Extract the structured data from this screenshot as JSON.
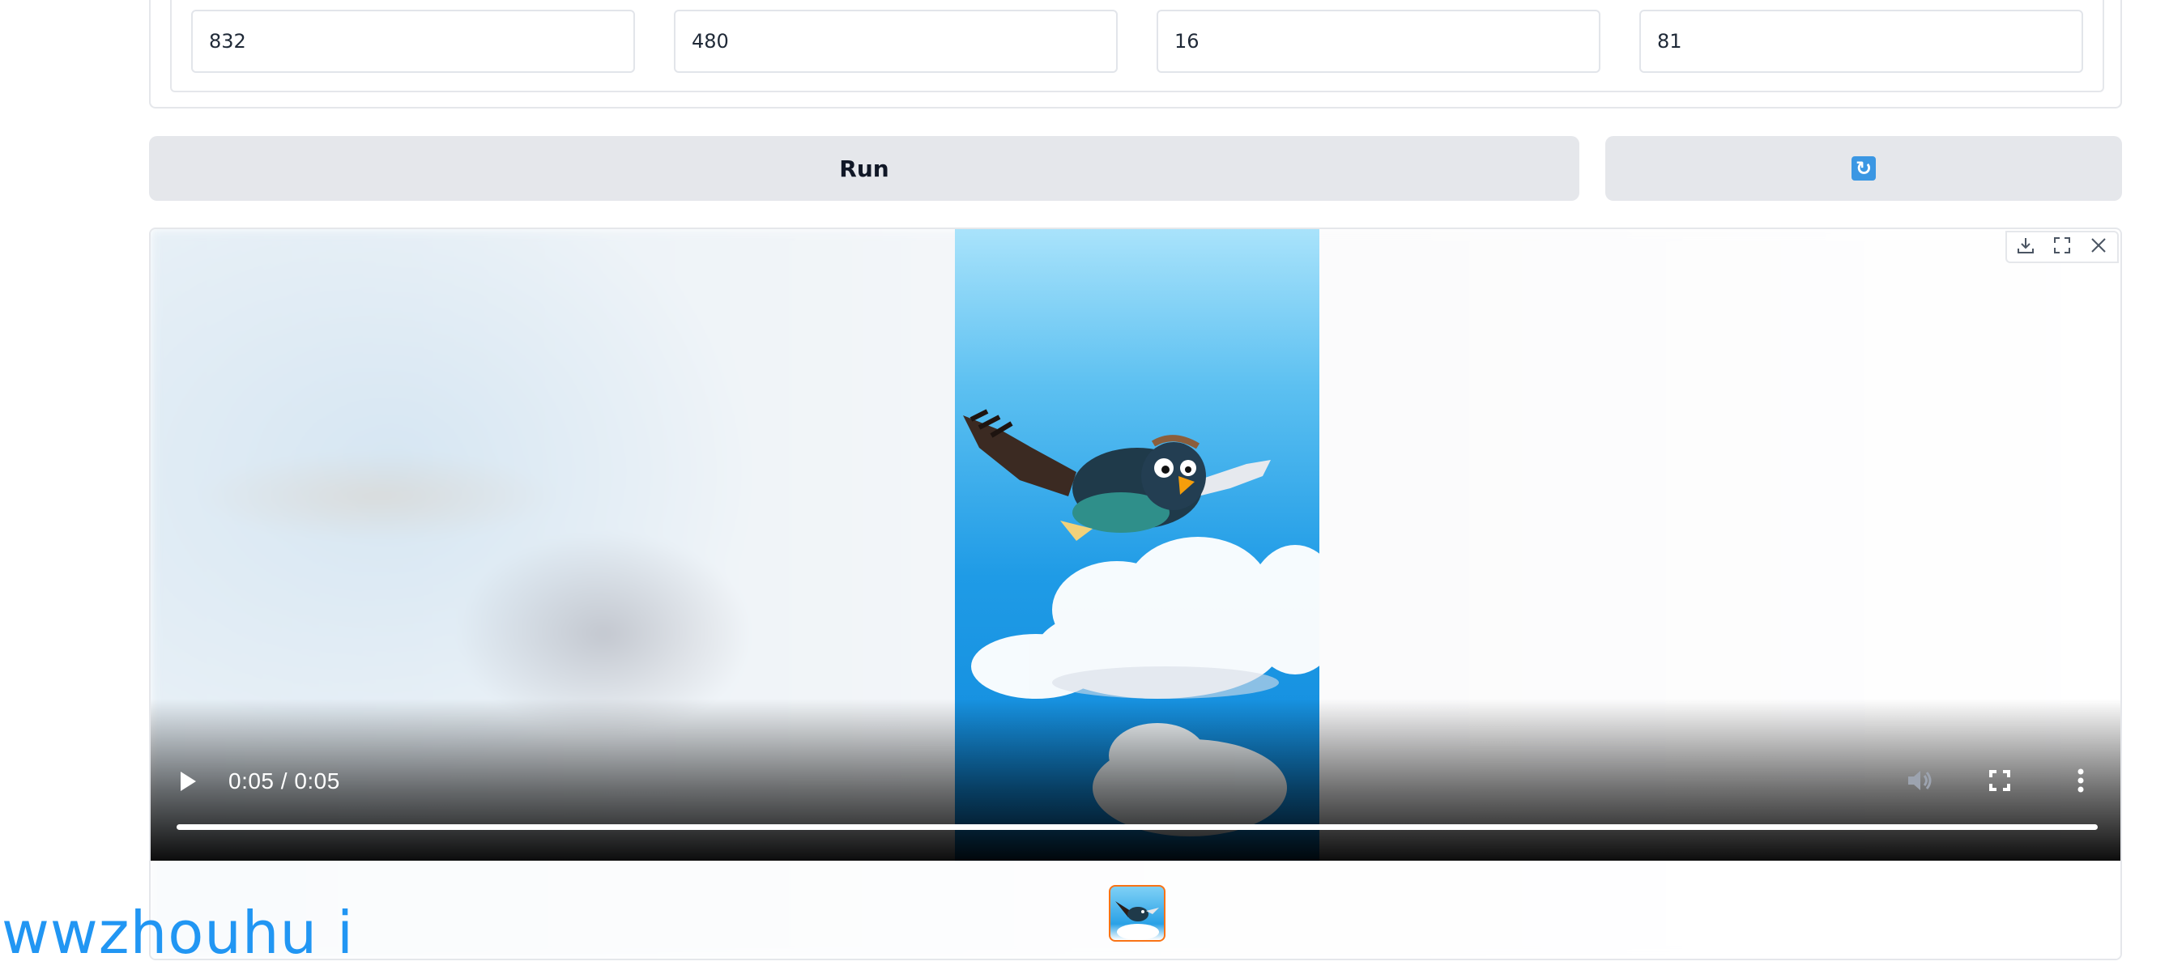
{
  "inputs": [
    {
      "name": "width-input",
      "value": "832"
    },
    {
      "name": "height-input",
      "value": "480"
    },
    {
      "name": "fps-input",
      "value": "16"
    },
    {
      "name": "frames-input",
      "value": "81"
    }
  ],
  "buttons": {
    "run_label": "Run",
    "refresh_icon": "refresh-icon"
  },
  "video": {
    "time_display": "0:05 / 0:05",
    "progress": 1.0,
    "icons": [
      "play-icon",
      "mute-icon",
      "fullscreen-icon",
      "more-options-icon"
    ],
    "top_actions": [
      "download-icon",
      "expand-icon",
      "close-icon"
    ]
  },
  "watermark": "wwzhouhu i",
  "colors": {
    "button_bg": "#e5e7eb",
    "refresh_accent": "#3b97e3",
    "thumb_border": "#f97316",
    "watermark": "#2196f3"
  }
}
